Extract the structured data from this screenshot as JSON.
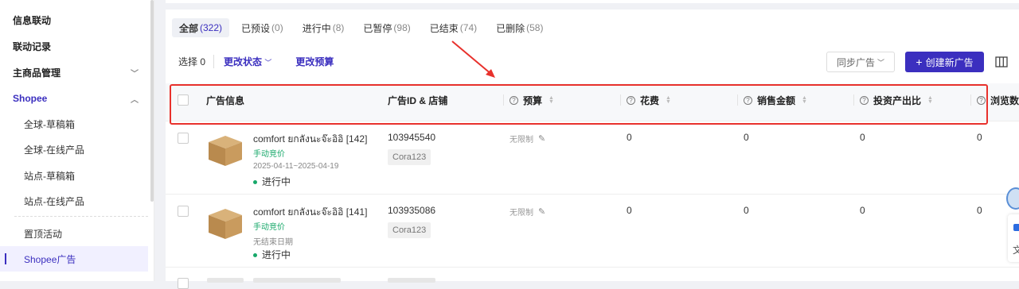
{
  "sidebar": {
    "items": [
      {
        "label": "信息联动",
        "kind": "top"
      },
      {
        "label": "联动记录",
        "kind": "top"
      },
      {
        "label": "主商品管理",
        "kind": "top",
        "chevron": "chevron-down"
      },
      {
        "label": "Shopee",
        "kind": "top",
        "chevron": "chevron-up",
        "expanded": true
      },
      {
        "label": "全球-草稿箱",
        "kind": "sub"
      },
      {
        "label": "全球-在线产品",
        "kind": "sub"
      },
      {
        "label": "站点-草稿箱",
        "kind": "sub"
      },
      {
        "label": "站点-在线产品",
        "kind": "sub"
      },
      {
        "label": "置顶活动",
        "kind": "sub"
      },
      {
        "label": "Shopee广告",
        "kind": "sub",
        "selected": true
      }
    ]
  },
  "tabs": [
    {
      "label": "全部",
      "count": "(322)",
      "active": true
    },
    {
      "label": "已预设",
      "count": "(0)"
    },
    {
      "label": "进行中",
      "count": "(8)"
    },
    {
      "label": "已暂停",
      "count": "(98)"
    },
    {
      "label": "已结束",
      "count": "(74)"
    },
    {
      "label": "已删除",
      "count": "(58)"
    }
  ],
  "toolbar": {
    "selected_label": "选择 0",
    "change_status": "更改状态",
    "change_budget": "更改预算",
    "sync_label": "同步广告",
    "create_label": "创建新广告"
  },
  "columns": {
    "ad_info": "广告信息",
    "ad_id_shop": "广告ID & 店铺",
    "budget": "预算",
    "spend": "花费",
    "sales": "销售金额",
    "roas": "投资产出比",
    "views": "浏览数"
  },
  "rows": [
    {
      "name": "comfort ยกลังนะจ๊ะอิอิ [142]",
      "bid_type": "手动竞价",
      "dates": "2025-04-11~2025-04-19",
      "status": "进行中",
      "ad_id": "103945540",
      "shop": "Cora123",
      "budget": "无限制",
      "spend": "0",
      "sales": "0",
      "roas": "0",
      "views": "0"
    },
    {
      "name": "comfort ยกลังนะจ๊ะอิอิ [141]",
      "bid_type": "手动竞价",
      "dates": "无结束日期",
      "status": "进行中",
      "ad_id": "103935086",
      "shop": "Cora123",
      "budget": "无限制",
      "spend": "0",
      "sales": "0",
      "roas": "0",
      "views": "0"
    }
  ],
  "colors": {
    "accent": "#3b2fbf",
    "highlight_box": "#e8312c",
    "status_green": "#17a86a"
  }
}
